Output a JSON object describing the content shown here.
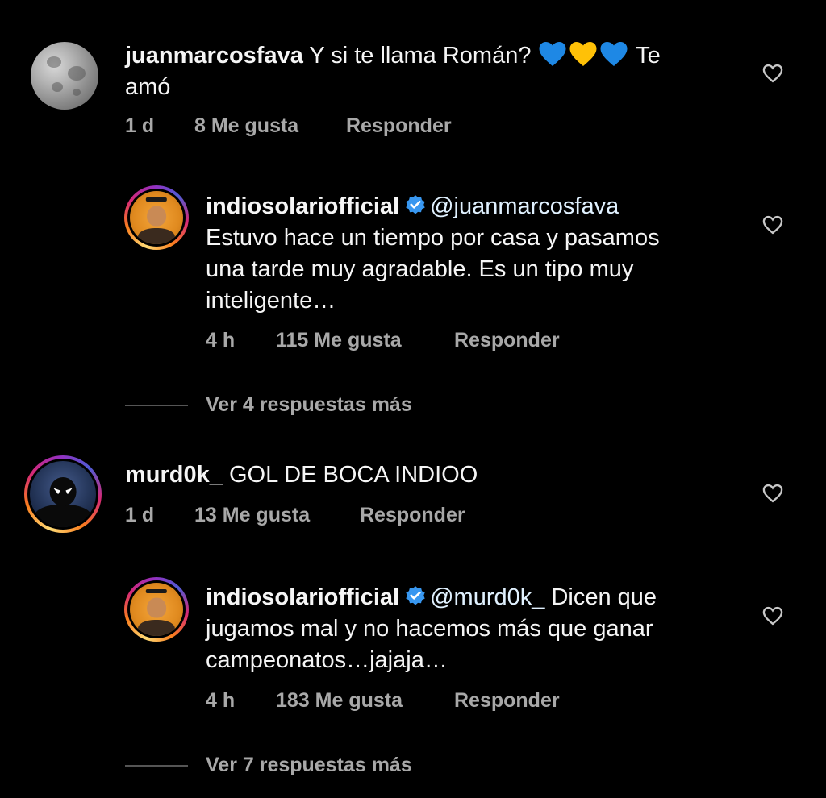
{
  "comments": [
    {
      "username": "juanmarcosfava",
      "text_line1": "Y si te llama Román?",
      "text_tail": "Te",
      "text_line2": "amó",
      "emojis": [
        "blue-heart",
        "yellow-heart",
        "blue-heart"
      ],
      "emoji_colors": [
        "#1e88e5",
        "#ffc107",
        "#1e88e5"
      ],
      "time": "1 d",
      "likes": "8 Me gusta",
      "reply_label": "Responder",
      "avatar": "moon-avatar"
    },
    {
      "username": "indiosolariofficial",
      "mention": "@juanmarcosfava",
      "text_line1": "Estuvo hace un tiempo por casa y pasamos",
      "text_line2": "una tarde muy agradable. Es un tipo muy",
      "text_line3": "inteligente…",
      "time": "4 h",
      "likes": "115 Me gusta",
      "reply_label": "Responder",
      "avatar": "indio-avatar"
    },
    {
      "more_replies": "Ver 4 respuestas más"
    },
    {
      "username": "murd0k_",
      "text_line1": "GOL DE BOCA INDIOO",
      "time": "1 d",
      "likes": "13 Me gusta",
      "reply_label": "Responder",
      "avatar": "spiderman-avatar"
    },
    {
      "username": "indiosolariofficial",
      "mention": "@murd0k_",
      "text_line1": "Dicen que",
      "text_line2": "jugamos mal y no hacemos más que ganar",
      "text_line3": "campeonatos…jajaja…",
      "time": "4 h",
      "likes": "183 Me gusta",
      "reply_label": "Responder",
      "avatar": "indio-avatar"
    },
    {
      "more_replies": "Ver 7 respuestas más"
    }
  ],
  "colors": {
    "background": "#000000",
    "text": "#f5f5f5",
    "meta": "#a8a8a8",
    "verified": "#3897f0"
  }
}
